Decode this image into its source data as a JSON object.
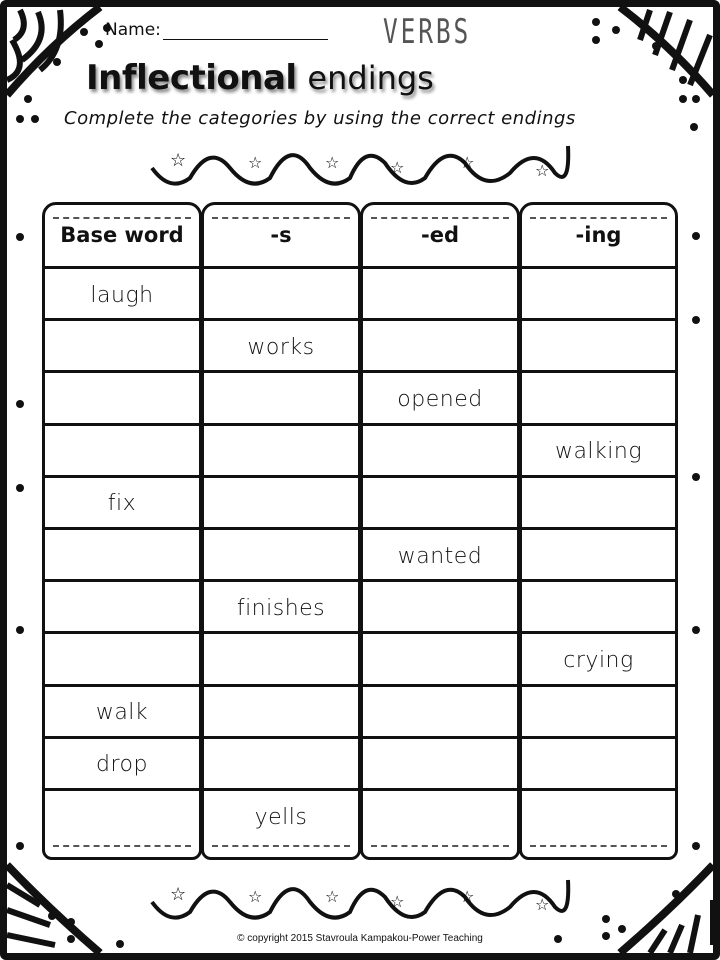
{
  "header": {
    "name_label": "Name:",
    "category": "VERBS",
    "title_bold": "Inflectional",
    "title_rest": "endings",
    "instructions": "Complete the categories by using the correct endings"
  },
  "table": {
    "columns": [
      "Base word",
      "-s",
      "-ed",
      "-ing"
    ],
    "rows": [
      [
        "laugh",
        "",
        "",
        ""
      ],
      [
        "",
        "works",
        "",
        ""
      ],
      [
        "",
        "",
        "opened",
        ""
      ],
      [
        "",
        "",
        "",
        "walking"
      ],
      [
        "fix",
        "",
        "",
        ""
      ],
      [
        "",
        "",
        "wanted",
        ""
      ],
      [
        "",
        "finishes",
        "",
        ""
      ],
      [
        "",
        "",
        "",
        "crying"
      ],
      [
        "walk",
        "",
        "",
        ""
      ],
      [
        "drop",
        "",
        "",
        ""
      ],
      [
        "",
        "yells",
        "",
        ""
      ]
    ]
  },
  "footer": {
    "copyright": "© copyright 2015 Stavroula Kampakou-Power Teaching"
  }
}
